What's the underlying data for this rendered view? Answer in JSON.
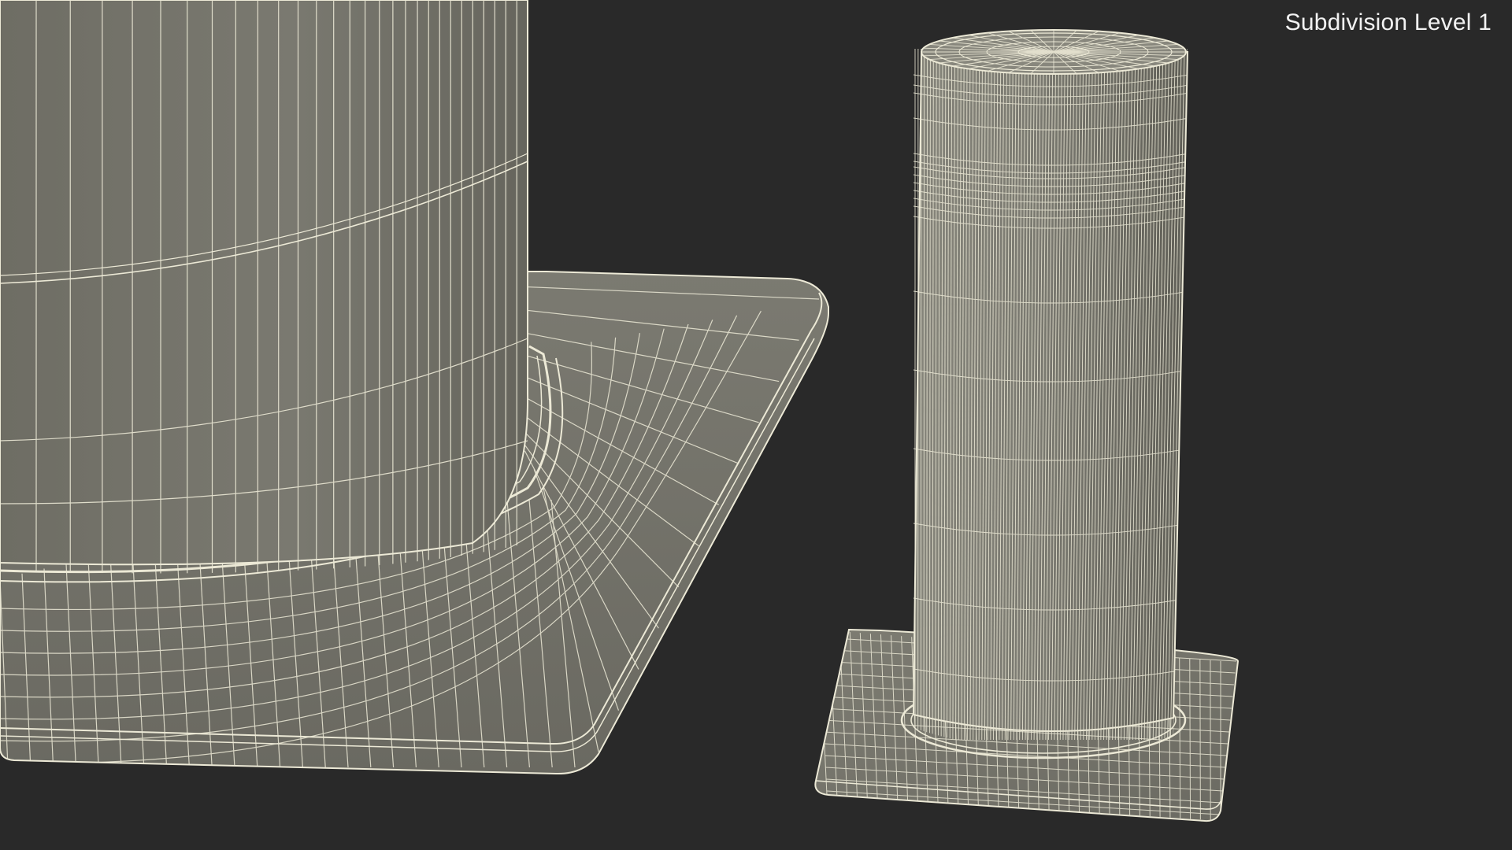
{
  "viewport": {
    "overlay_text": "Subdivision Level 1"
  },
  "scene": {
    "background_color": "#292929",
    "surface_color": "#74736a",
    "surface_shadow_color": "#5f5e56",
    "surface_highlight_color": "#8a897f",
    "wire_color": "#ece9d6"
  }
}
